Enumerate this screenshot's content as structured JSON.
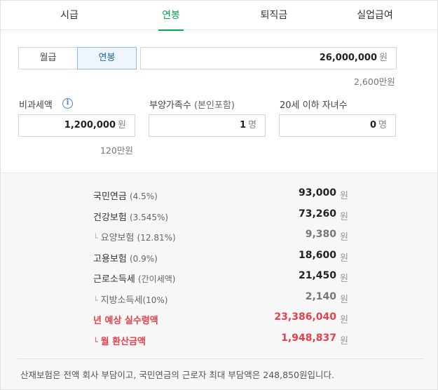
{
  "tabs": [
    {
      "label": "시급"
    },
    {
      "label": "연봉"
    },
    {
      "label": "퇴직금"
    },
    {
      "label": "실업급여"
    }
  ],
  "mode": {
    "monthly": "월급",
    "annual": "연봉",
    "selected": "연봉"
  },
  "salary": {
    "value": "26,000,000",
    "unit": "원",
    "hint": "2,600만원"
  },
  "nontax": {
    "label": "비과세액",
    "info_icon": "info-icon",
    "value": "1,200,000",
    "unit": "원",
    "hint": "120만원"
  },
  "dependents": {
    "label": "부양가족수",
    "label_note": "(본인포함)",
    "value": "1",
    "unit": "명"
  },
  "children": {
    "label": "20세 이하 자녀수",
    "value": "0",
    "unit": "명"
  },
  "results": [
    {
      "name": "국민연금",
      "rate": "(4.5%)",
      "value": "93,000",
      "unit": "원"
    },
    {
      "name": "건강보험",
      "rate": "(3.545%)",
      "value": "73,260",
      "unit": "원"
    },
    {
      "name": "요양보험",
      "rate": "(12.81%)",
      "value": "9,380",
      "unit": "원"
    },
    {
      "name": "고용보험",
      "rate": "(0.9%)",
      "value": "18,600",
      "unit": "원"
    },
    {
      "name": "근로소득세",
      "rate": "(간이세액)",
      "value": "21,450",
      "unit": "원"
    },
    {
      "name": "지방소득세",
      "rate": "(10%)",
      "value": "2,140",
      "unit": "원"
    },
    {
      "name": "년 예상 실수령액",
      "rate": "",
      "value": "23,386,040",
      "unit": "원"
    },
    {
      "name": "월 환산금액",
      "rate": "",
      "value": "1,948,837",
      "unit": "원"
    }
  ],
  "note": "산재보험은 전액 회사 부담이고, 국민연금의 근로자 최대 부담액은 248,850원입니다.",
  "colors": {
    "accent": "#03a94d",
    "selected": "#1a64c4",
    "highlight": "#e5404b"
  }
}
